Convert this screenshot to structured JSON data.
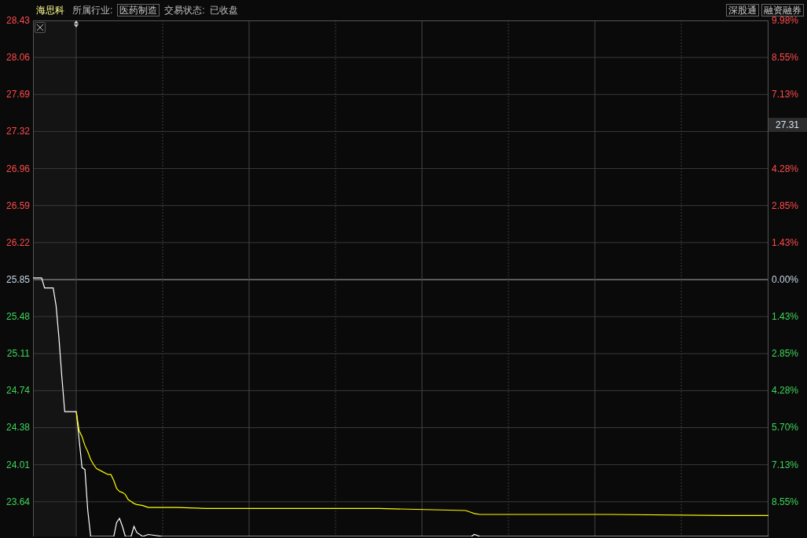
{
  "header": {
    "stock": "海思科",
    "industry_label": "所属行业:",
    "industry": "医药制造",
    "status_label": "交易状态:",
    "status": "已收盘"
  },
  "header_buttons": [
    "深股通",
    "融资融券"
  ],
  "price_axis": [
    {
      "label": "28.43",
      "color": "#ff4a4a"
    },
    {
      "label": "28.06",
      "color": "#ff4a4a"
    },
    {
      "label": "27.69",
      "color": "#ff4a4a"
    },
    {
      "label": "27.32",
      "color": "#ff4a4a"
    },
    {
      "label": "26.96",
      "color": "#ff4a4a"
    },
    {
      "label": "26.59",
      "color": "#ff4a4a"
    },
    {
      "label": "26.22",
      "color": "#ff4a4a"
    },
    {
      "label": "25.85",
      "color": "#c6d4e4"
    },
    {
      "label": "25.48",
      "color": "#3fd45a"
    },
    {
      "label": "25.11",
      "color": "#3fd45a"
    },
    {
      "label": "24.74",
      "color": "#3fd45a"
    },
    {
      "label": "24.38",
      "color": "#3fd45a"
    },
    {
      "label": "24.01",
      "color": "#3fd45a"
    },
    {
      "label": "23.64",
      "color": "#3fd45a"
    }
  ],
  "percent_axis": [
    {
      "kind": "percent",
      "label": "9.98%",
      "color": "#ff4a4a"
    },
    {
      "kind": "percent",
      "label": "8.55%",
      "color": "#ff4a4a"
    },
    {
      "kind": "percent",
      "label": "7.13%",
      "color": "#ff4a4a"
    },
    {
      "kind": "tag",
      "label": "27.31"
    },
    {
      "kind": "percent",
      "label": "4.28%",
      "color": "#ff4a4a"
    },
    {
      "kind": "percent",
      "label": "2.85%",
      "color": "#ff4a4a"
    },
    {
      "kind": "percent",
      "label": "1.43%",
      "color": "#ff4a4a"
    },
    {
      "kind": "percent",
      "label": "0.00%",
      "color": "#c6d4e4"
    },
    {
      "kind": "percent",
      "label": "1.43%",
      "color": "#3fd45a"
    },
    {
      "kind": "percent",
      "label": "2.85%",
      "color": "#3fd45a"
    },
    {
      "kind": "percent",
      "label": "4.28%",
      "color": "#3fd45a"
    },
    {
      "kind": "percent",
      "label": "5.70%",
      "color": "#3fd45a"
    },
    {
      "kind": "percent",
      "label": "7.13%",
      "color": "#3fd45a"
    },
    {
      "kind": "percent",
      "label": "8.55%",
      "color": "#3fd45a"
    }
  ]
}
